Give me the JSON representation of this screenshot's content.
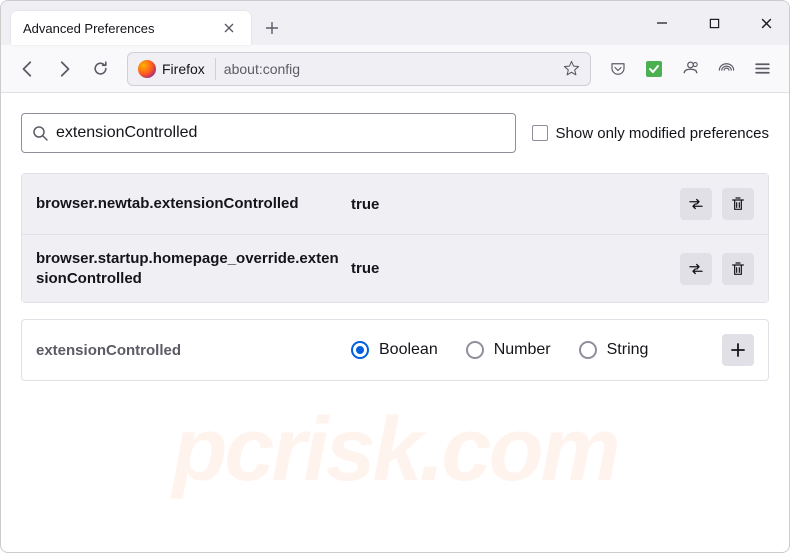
{
  "tab": {
    "title": "Advanced Preferences"
  },
  "url_bar": {
    "identity": "Firefox",
    "url": "about:config"
  },
  "search": {
    "value": "extensionControlled",
    "checkbox_label": "Show only modified preferences"
  },
  "preferences": [
    {
      "name": "browser.newtab.extensionControlled",
      "value": "true"
    },
    {
      "name": "browser.startup.homepage_override.extensionControlled",
      "value": "true"
    }
  ],
  "create": {
    "name": "extensionControlled",
    "types": [
      "Boolean",
      "Number",
      "String"
    ],
    "selected": 0
  },
  "watermark": "pcrisk.com"
}
